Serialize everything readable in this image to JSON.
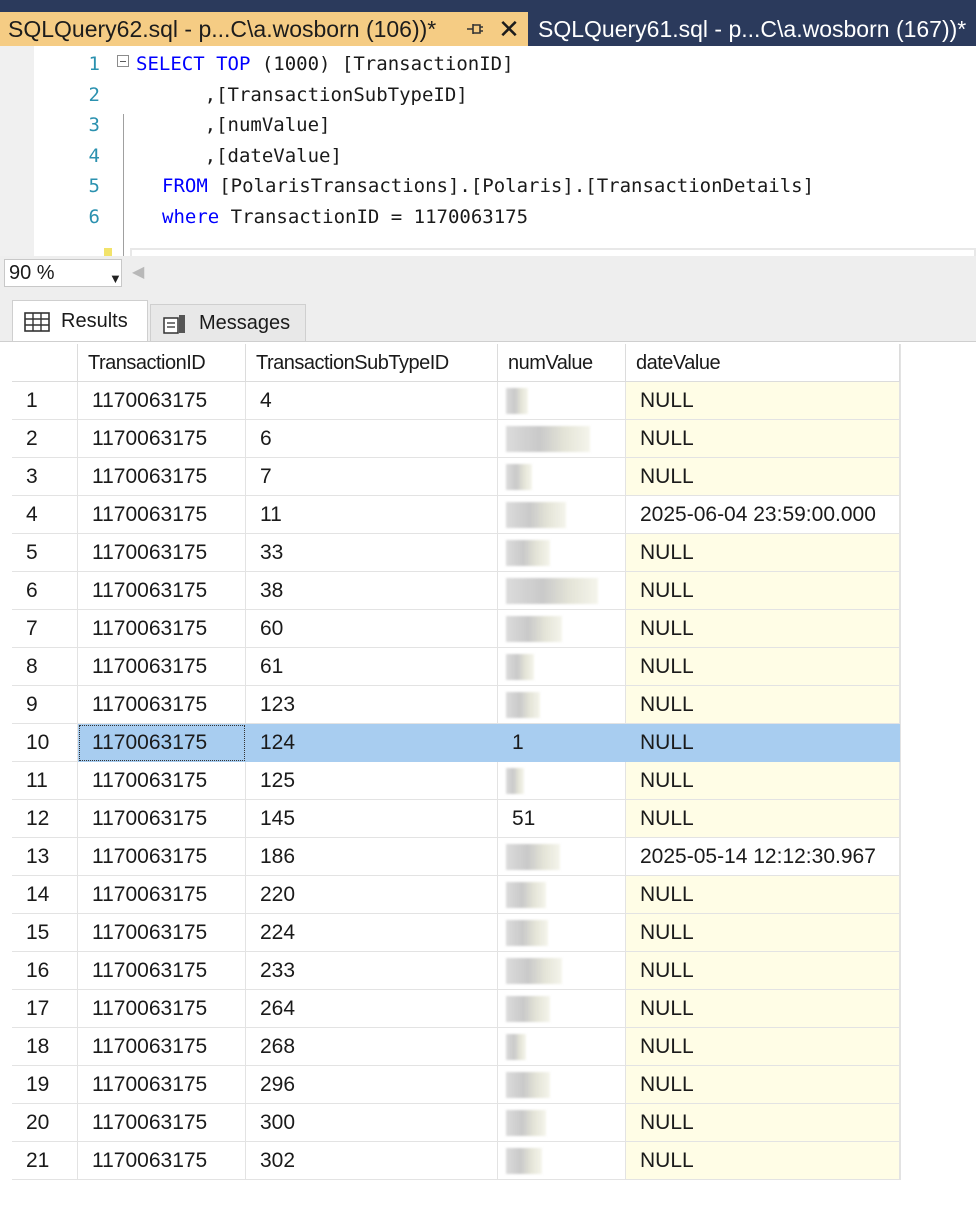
{
  "tabs": [
    {
      "title": "SQLQuery62.sql - p...C\\a.wosborn (106))*",
      "active": true
    },
    {
      "title": "SQLQuery61.sql - p...C\\a.wosborn (167))*",
      "active": false
    }
  ],
  "icons": {
    "pin": "pin-icon",
    "close": "close-icon"
  },
  "editor": {
    "lines": [
      {
        "num": "1",
        "parts": [
          {
            "t": "SELECT",
            "c": "kw"
          },
          {
            "t": " ",
            "c": ""
          },
          {
            "t": "TOP",
            "c": "kw"
          },
          {
            "t": " (1000) [TransactionID]",
            "c": "gr_mix"
          }
        ]
      },
      {
        "num": "2",
        "text": "      ,[TransactionSubTypeID]"
      },
      {
        "num": "3",
        "text": "      ,[numValue]"
      },
      {
        "num": "4",
        "text": "      ,[dateValue]"
      },
      {
        "num": "5",
        "kw": "FROM",
        "text": " [PolarisTransactions].[Polaris].[TransactionDetails]"
      },
      {
        "num": "6",
        "kw": "where",
        "text": " TransactionID = 1170063175"
      }
    ]
  },
  "zoom": {
    "value": "90 %"
  },
  "results_tabs": {
    "results": "Results",
    "messages": "Messages"
  },
  "grid": {
    "columns": [
      "",
      "TransactionID",
      "TransactionSubTypeID",
      "numValue",
      "dateValue"
    ],
    "rows": [
      {
        "n": "1",
        "tid": "1170063175",
        "sub": "4",
        "num": "",
        "date": "NULL"
      },
      {
        "n": "2",
        "tid": "1170063175",
        "sub": "6",
        "num": "",
        "date": "NULL"
      },
      {
        "n": "3",
        "tid": "1170063175",
        "sub": "7",
        "num": "",
        "date": "NULL"
      },
      {
        "n": "4",
        "tid": "1170063175",
        "sub": "11",
        "num": "",
        "date": "2025-06-04 23:59:00.000"
      },
      {
        "n": "5",
        "tid": "1170063175",
        "sub": "33",
        "num": "",
        "date": "NULL"
      },
      {
        "n": "6",
        "tid": "1170063175",
        "sub": "38",
        "num": "",
        "date": "NULL"
      },
      {
        "n": "7",
        "tid": "1170063175",
        "sub": "60",
        "num": "",
        "date": "NULL"
      },
      {
        "n": "8",
        "tid": "1170063175",
        "sub": "61",
        "num": "",
        "date": "NULL"
      },
      {
        "n": "9",
        "tid": "1170063175",
        "sub": "123",
        "num": "",
        "date": "NULL"
      },
      {
        "n": "10",
        "tid": "1170063175",
        "sub": "124",
        "num": "1",
        "date": "NULL",
        "selected": true
      },
      {
        "n": "11",
        "tid": "1170063175",
        "sub": "125",
        "num": "",
        "date": "NULL"
      },
      {
        "n": "12",
        "tid": "1170063175",
        "sub": "145",
        "num": "51",
        "date": "NULL"
      },
      {
        "n": "13",
        "tid": "1170063175",
        "sub": "186",
        "num": "",
        "date": "2025-05-14 12:12:30.967"
      },
      {
        "n": "14",
        "tid": "1170063175",
        "sub": "220",
        "num": "",
        "date": "NULL"
      },
      {
        "n": "15",
        "tid": "1170063175",
        "sub": "224",
        "num": "",
        "date": "NULL"
      },
      {
        "n": "16",
        "tid": "1170063175",
        "sub": "233",
        "num": "",
        "date": "NULL"
      },
      {
        "n": "17",
        "tid": "1170063175",
        "sub": "264",
        "num": "",
        "date": "NULL"
      },
      {
        "n": "18",
        "tid": "1170063175",
        "sub": "268",
        "num": "",
        "date": "NULL"
      },
      {
        "n": "19",
        "tid": "1170063175",
        "sub": "296",
        "num": "",
        "date": "NULL"
      },
      {
        "n": "20",
        "tid": "1170063175",
        "sub": "300",
        "num": "",
        "date": "NULL"
      },
      {
        "n": "21",
        "tid": "1170063175",
        "sub": "302",
        "num": "",
        "date": "NULL"
      }
    ]
  },
  "colors": {
    "active_tab": "#f5cc84",
    "tabstrip": "#2b3a5c",
    "selection": "#a8cdf0",
    "null_cell": "#fffde6",
    "keyword": "#0000ff"
  }
}
